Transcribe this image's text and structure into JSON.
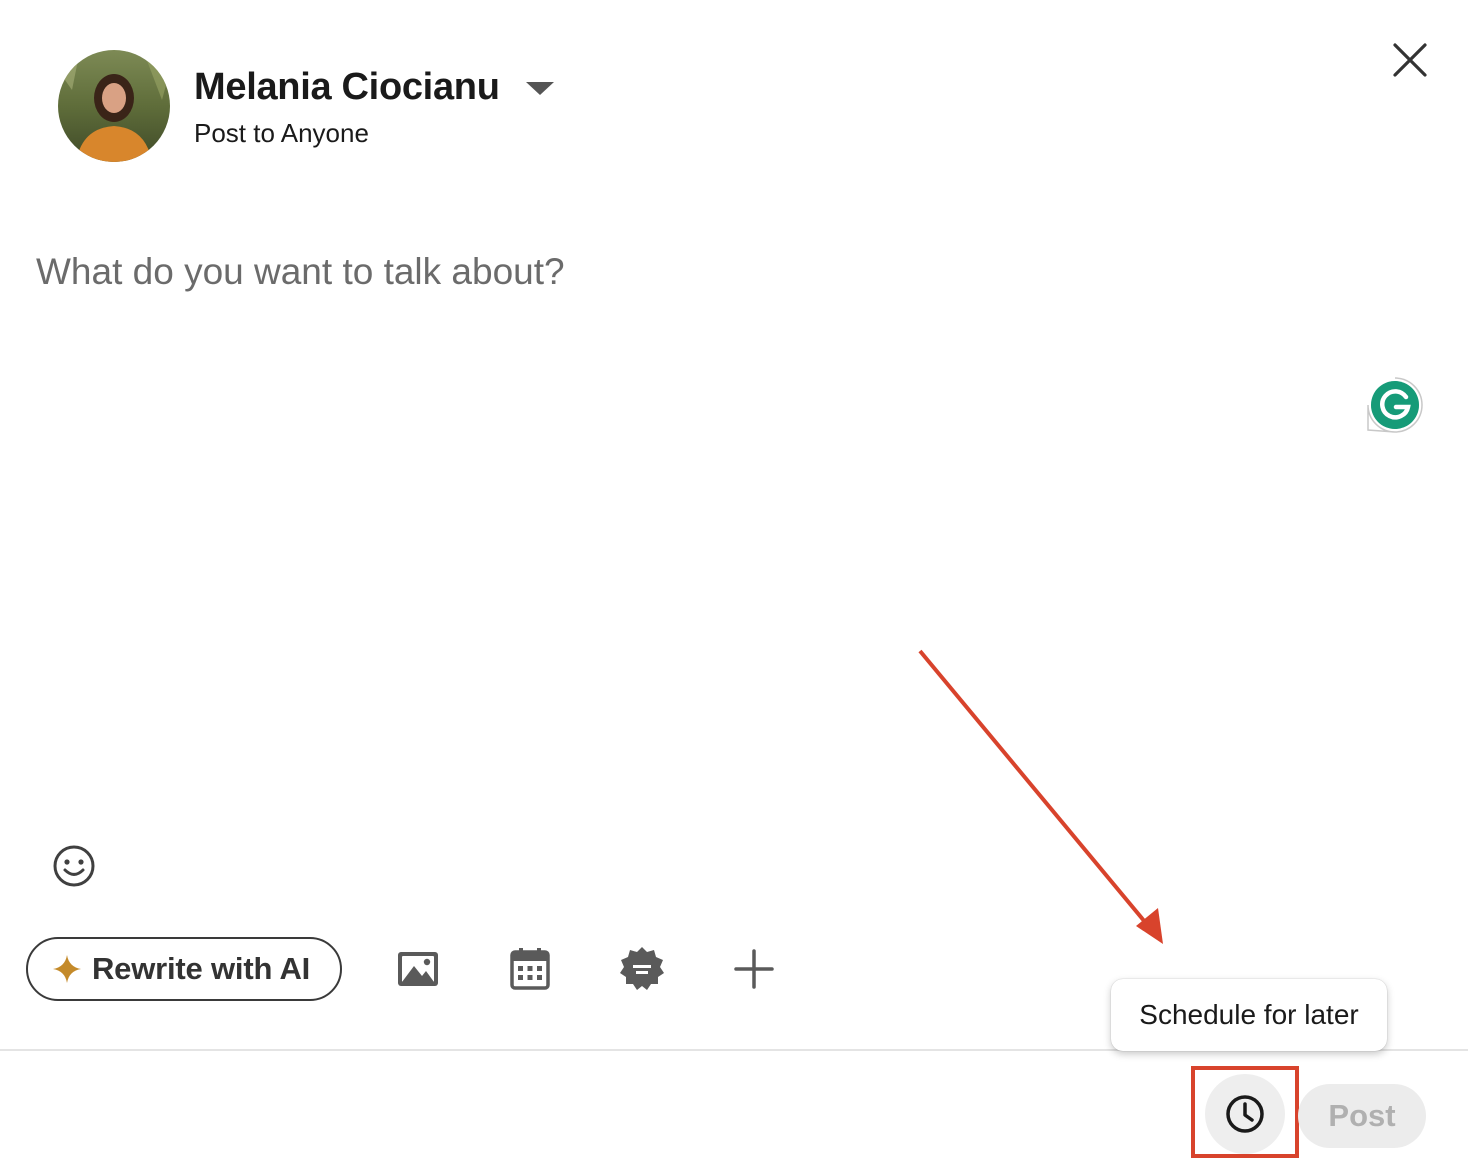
{
  "author": {
    "name": "Melania Ciocianu",
    "audience": "Post to Anyone"
  },
  "editor": {
    "placeholder": "What do you want to talk about?"
  },
  "toolbar": {
    "rewrite_label": "Rewrite with AI",
    "tools": [
      "image-icon",
      "calendar-icon",
      "badge-icon",
      "plus-icon"
    ]
  },
  "tooltip": {
    "text": "Schedule for later"
  },
  "footer": {
    "post_label": "Post",
    "post_enabled": false
  },
  "colors": {
    "annotation_red": "#d8432c",
    "ai_sparkle": "#c48a2a",
    "grammarly_green": "#15a37f",
    "post_disabled_bg": "#ececec",
    "post_disabled_text": "#b0b0b0"
  }
}
